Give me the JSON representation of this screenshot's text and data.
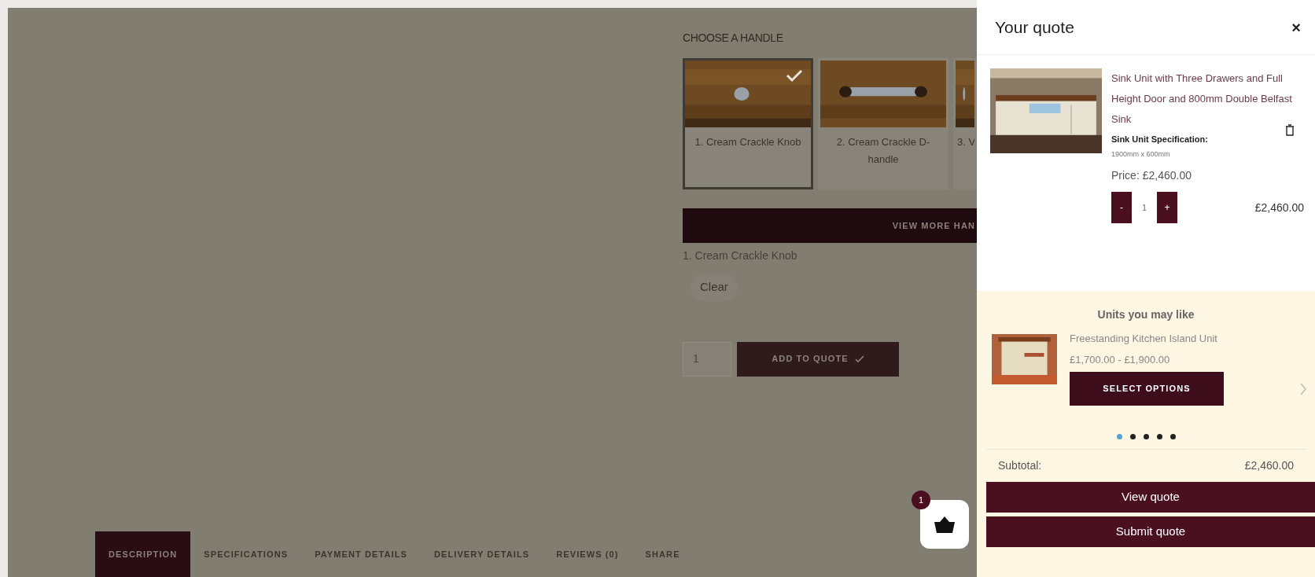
{
  "product_options": {
    "heading": "CHOOSE A HANDLE",
    "handles": [
      {
        "label": "1. Cream Crackle Knob",
        "selected": true
      },
      {
        "label": "2. Cream Crackle D-handle",
        "selected": false
      },
      {
        "label": "3. V",
        "selected": false
      }
    ],
    "view_more_button": "VIEW MORE HAN",
    "chosen_label": "1. Cream Crackle Knob",
    "clear_button": "Clear",
    "quantity": "1",
    "add_button": "ADD TO QUOTE"
  },
  "tabs": [
    {
      "label": "DESCRIPTION",
      "selected": true
    },
    {
      "label": "SPECIFICATIONS",
      "selected": false
    },
    {
      "label": "PAYMENT DETAILS",
      "selected": false
    },
    {
      "label": "DELIVERY DETAILS",
      "selected": false
    },
    {
      "label": "REVIEWS (0)",
      "selected": false
    },
    {
      "label": "SHARE",
      "selected": false
    }
  ],
  "quote_button": {
    "badge": "1"
  },
  "quote_drawer": {
    "title": "Your quote",
    "close": "×",
    "item": {
      "name": "Sink Unit with Three Drawers and Full Height Door and 800mm Double Belfast Sink",
      "spec_label": "Sink Unit Specification:",
      "spec_value": "1900mm x 600mm",
      "price": "Price: £2,460.00",
      "minus": "-",
      "quantity": "1",
      "plus": "+",
      "total": "£2,460.00"
    },
    "suggestions": {
      "heading": "Units you may like",
      "name": "Freestanding Kitchen Island Unit",
      "price": "£1,700.00 - £1,900.00",
      "button": "SELECT OPTIONS",
      "dots": [
        {
          "selected": true
        },
        {
          "selected": false
        },
        {
          "selected": false
        },
        {
          "selected": false
        },
        {
          "selected": false
        }
      ]
    },
    "subtotal_label": "Subtotal:",
    "subtotal": "£2,460.00",
    "buttons": [
      "View quote",
      "Submit quote"
    ]
  }
}
